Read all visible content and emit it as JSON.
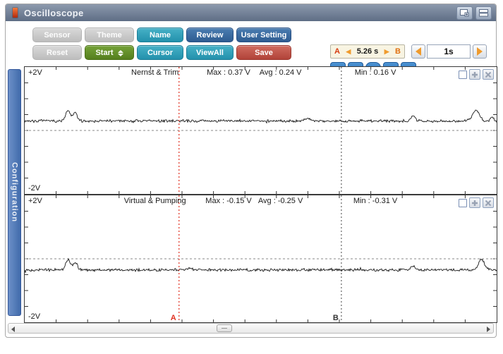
{
  "window": {
    "title": "Oscilloscope"
  },
  "toolbar": {
    "buttons_row1": [
      {
        "label": "Sensor",
        "state": "disabled"
      },
      {
        "label": "Theme",
        "state": "disabled"
      },
      {
        "label": "Name",
        "state": "enabled"
      },
      {
        "label": "Review",
        "state": "enabled"
      },
      {
        "label": "User Setting",
        "state": "enabled"
      }
    ],
    "buttons_row2": [
      {
        "label": "Reset",
        "state": "disabled"
      },
      {
        "label": "Start",
        "state": "enabled"
      },
      {
        "label": "Cursor",
        "state": "enabled"
      },
      {
        "label": "ViewAll",
        "state": "enabled"
      },
      {
        "label": "Save",
        "state": "enabled"
      }
    ]
  },
  "cursor_readout": {
    "a_label": "A",
    "b_label": "B",
    "delta": "5.26 s"
  },
  "timebase": {
    "value": "1s"
  },
  "playback_icons": [
    "skip-to-start-icon",
    "step-back-icon",
    "stop-icon",
    "play-icon",
    "skip-to-end-icon"
  ],
  "window_icons": [
    "popout-window-icon",
    "window-shade-icon"
  ],
  "sidebar": {
    "label": "Configuration"
  },
  "panels": [
    {
      "v_top": "+2V",
      "v_bottom": "-2V",
      "title": "Nernst & Trim",
      "max": "Max : 0.37 V",
      "avg": "Avg : 0.24 V",
      "min": "Min : 0.16 V"
    },
    {
      "v_top": "+2V",
      "v_bottom": "-2V",
      "title": "Virtual & Pumping",
      "max": "Max : -0.15 V",
      "avg": "Avg : -0.25 V",
      "min": "Min : -0.31 V"
    }
  ],
  "cursors": {
    "a_label": "A",
    "b_label": "B",
    "a_frac": 0.327,
    "b_frac": 0.671,
    "a_color": "#e03020",
    "b_color": "#444444"
  },
  "colors": {
    "accent_teal": "#2E9CB5",
    "accent_blue": "#33689E",
    "accent_green": "#5C8A28",
    "accent_red": "#C14F44",
    "disabled_gray": "#C9C9C9",
    "playback_blue": "#2F7BC0",
    "titlebar": "#6B7A92",
    "config_tab_blue": "#4A72B8",
    "readout_bg": "#F8F4E2",
    "arrow_orange": "#F09B2D",
    "waveform": "#1A1A1A"
  },
  "chart_data": [
    {
      "type": "line",
      "title": "Nernst & Trim",
      "ylim": [
        -2,
        2
      ],
      "units": "V",
      "y_top_label": "+2V",
      "y_bottom_label": "-2V",
      "stats": {
        "max": 0.37,
        "avg": 0.24,
        "min": 0.16
      },
      "baseline_v": 0.3,
      "noise_v": 0.05,
      "zero_line_v": 0,
      "seed": 7,
      "peaks": [
        {
          "pos": 0.092,
          "height": 0.32,
          "width": 0.007
        },
        {
          "pos": 0.107,
          "height": 0.26,
          "width": 0.006
        },
        {
          "pos": 0.6,
          "height": 0.09,
          "width": 0.008
        },
        {
          "pos": 0.823,
          "height": 0.16,
          "width": 0.006
        },
        {
          "pos": 0.956,
          "height": 0.34,
          "width": 0.01
        },
        {
          "pos": 0.99,
          "height": 0.1,
          "width": 0.005
        }
      ]
    },
    {
      "type": "line",
      "title": "Virtual & Pumping",
      "ylim": [
        -2,
        2
      ],
      "units": "V",
      "y_top_label": "+2V",
      "y_bottom_label": "-2V",
      "stats": {
        "max": -0.15,
        "avg": -0.25,
        "min": -0.31
      },
      "baseline_v": -0.35,
      "noise_v": 0.05,
      "zero_line_v": 0,
      "seed": 13,
      "peaks": [
        {
          "pos": 0.092,
          "height": 0.33,
          "width": 0.007
        },
        {
          "pos": 0.107,
          "height": 0.25,
          "width": 0.006
        },
        {
          "pos": 0.35,
          "height": 0.06,
          "width": 0.006
        },
        {
          "pos": 0.823,
          "height": 0.13,
          "width": 0.006
        },
        {
          "pos": 0.968,
          "height": 0.35,
          "width": 0.008
        }
      ]
    }
  ]
}
